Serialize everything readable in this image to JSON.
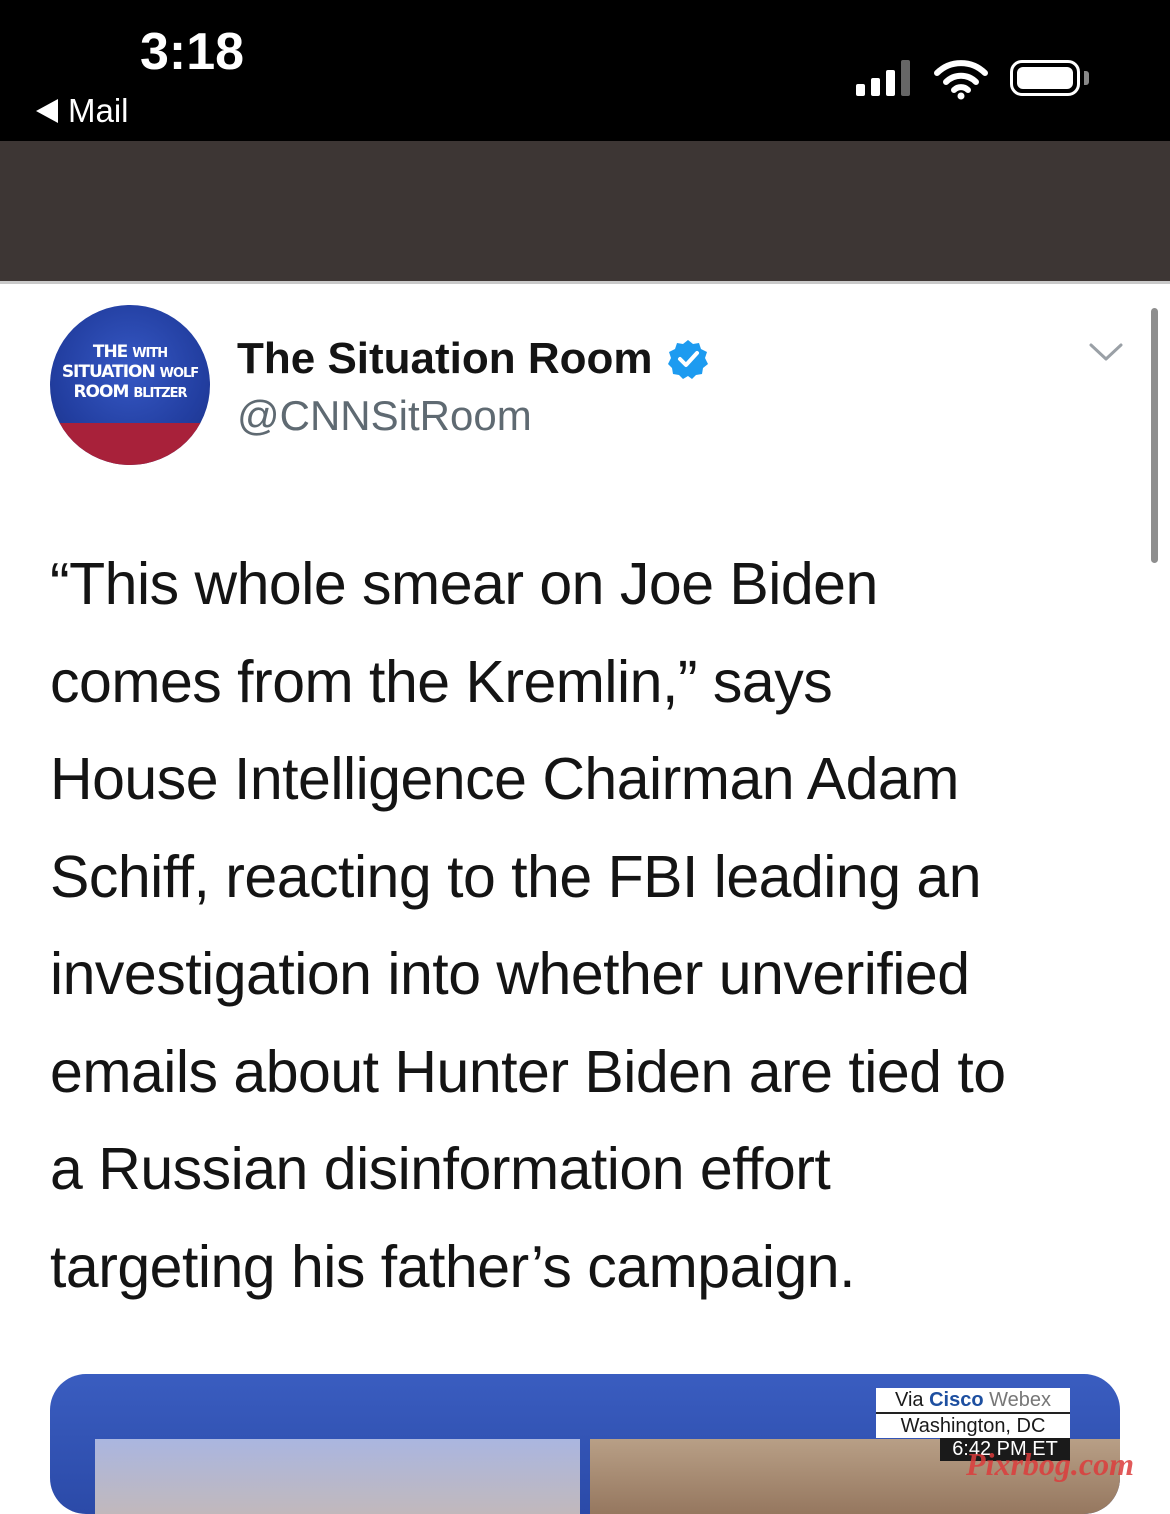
{
  "status_bar": {
    "time": "3:18",
    "back_label": "Mail",
    "icons": [
      "back-arrow-icon",
      "cellular-signal-icon",
      "wifi-icon",
      "battery-icon"
    ]
  },
  "tweet": {
    "avatar_text": [
      "THE",
      "WITH",
      "SITUATION",
      "WOLF",
      "ROOM",
      "BLITZER"
    ],
    "display_name": "The Situation Room",
    "handle": "@CNNSitRoom",
    "lines": [
      "“This whole smear on Joe Biden",
      "comes from the Kremlin,” says",
      "House Intelligence Chairman Adam",
      "Schiff, reacting to the FBI leading an",
      "investigation into whether unverified",
      "emails about Hunter Biden are tied to",
      "a Russian disinformation effort",
      "targeting his father’s campaign."
    ]
  },
  "media": {
    "caption_via": "Via",
    "caption_cisco": "Cisco",
    "caption_webex": "Webex",
    "caption_location": "Washington, DC",
    "caption_time": "6:42 PM ET"
  },
  "watermark": "Pixrbog.com",
  "colors": {
    "verified": "#1d9bf0",
    "header_band": "#3d3634",
    "avatar_blue": "#223ea0",
    "avatar_red": "#a8213a"
  }
}
